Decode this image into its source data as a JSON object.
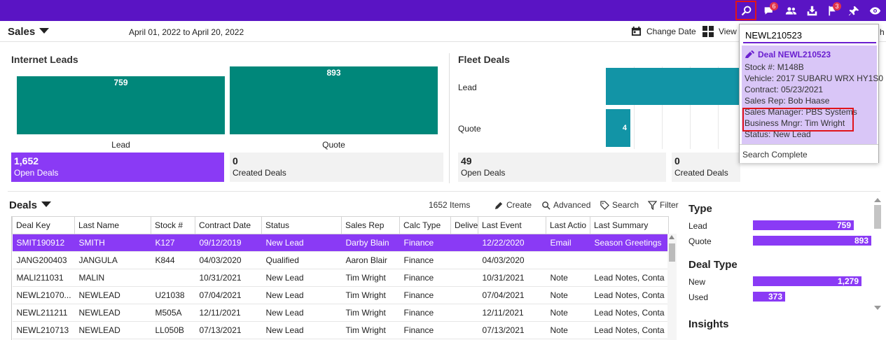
{
  "topbar": {
    "bg_color": "#5a14c4",
    "icons": [
      {
        "name": "search-icon",
        "badge": ""
      },
      {
        "name": "chat-icon",
        "badge": "6"
      },
      {
        "name": "people-icon",
        "badge": ""
      },
      {
        "name": "download-icon",
        "badge": ""
      },
      {
        "name": "flag-icon",
        "badge": "3"
      },
      {
        "name": "pin-icon",
        "badge": ""
      },
      {
        "name": "eye-icon",
        "badge": ""
      }
    ],
    "chat_badge": "6",
    "flag_badge": "3"
  },
  "subbar": {
    "title": "Sales",
    "date_range": "April 01, 2022 to April 20, 2022",
    "change_date_label": "Change Date",
    "view_label": "View",
    "truncated_label": "h"
  },
  "internet_leads": {
    "title": "Internet Leads",
    "bars": [
      {
        "label": "Lead",
        "value": "759"
      },
      {
        "label": "Quote",
        "value": "893"
      }
    ],
    "stats": [
      {
        "num": "1,652",
        "label": "Open Deals"
      },
      {
        "num": "0",
        "label": "Created Deals"
      }
    ]
  },
  "fleet_deals": {
    "title": "Fleet Deals",
    "rows": [
      {
        "label": "Lead",
        "value": ""
      },
      {
        "label": "Quote",
        "value": "4"
      }
    ],
    "stats": [
      {
        "num": "49",
        "label": "Open Deals"
      },
      {
        "num": "0",
        "label": "Created Deals"
      }
    ]
  },
  "deals": {
    "title": "Deals",
    "items_count": "1652 Items",
    "tools": {
      "create": "Create",
      "advanced": "Advanced",
      "search": "Search",
      "filter": "Filter"
    },
    "columns": [
      "Deal Key",
      "Last Name",
      "Stock #",
      "Contract Date",
      "Status",
      "Sales Rep",
      "Calc Type",
      "Delive",
      "Last Event",
      "Last Actio",
      "Last Summary"
    ],
    "rows": [
      [
        "SMIT190912",
        "SMITH",
        "K127",
        "09/12/2019",
        "New Lead",
        "Darby Blain",
        "Finance",
        "",
        "12/22/2020",
        "Email",
        "Season Greetings"
      ],
      [
        "JANG200403",
        "JANGULA",
        "K844",
        "04/03/2020",
        "Qualified",
        "Aaron Blair",
        "Finance",
        "",
        "04/03/2020",
        "",
        ""
      ],
      [
        "MALI211031",
        "MALIN",
        "",
        "10/31/2021",
        "New Lead",
        "Tim Wright",
        "Finance",
        "",
        "10/31/2021",
        "Note",
        "Lead Notes, Conta"
      ],
      [
        "NEWL21070...",
        "NEWLEAD",
        "U21038",
        "07/04/2021",
        "New Lead",
        "Tim Wright",
        "Finance",
        "",
        "07/04/2021",
        "Note",
        "Lead Notes, Conta"
      ],
      [
        "NEWL211211",
        "NEWLEAD",
        "M505A",
        "12/11/2021",
        "New Lead",
        "Tim Wright",
        "Finance",
        "",
        "12/11/2021",
        "Note",
        "Lead Notes, Conta"
      ],
      [
        "NEWL210713",
        "NEWLEAD",
        "LL050B",
        "07/13/2021",
        "New Lead",
        "Tim Wright",
        "Finance",
        "",
        "07/13/2021",
        "Note",
        "Lead Notes, Conta"
      ]
    ]
  },
  "right_panel": {
    "type_title": "Type",
    "type_rows": [
      {
        "label": "Lead",
        "value": "759"
      },
      {
        "label": "Quote",
        "value": "893"
      }
    ],
    "deal_type_title": "Deal Type",
    "deal_type_rows": [
      {
        "label": "New",
        "value": "1,279"
      },
      {
        "label": "Used",
        "value": "373"
      }
    ],
    "insights_title": "Insights"
  },
  "popup": {
    "search_value": "NEWL210523",
    "result_title": "Deal NEWL210523",
    "lines": [
      "Stock #: M148B",
      "Vehicle: 2017 SUBARU WRX HY1S0",
      "Contract: 05/23/2021",
      "Sales Rep: Bob Haase",
      "Sales Manager: PBS Systems",
      "Business Mngr: Tim Wright",
      "Status: New Lead"
    ],
    "footer": "Search Complete"
  }
}
